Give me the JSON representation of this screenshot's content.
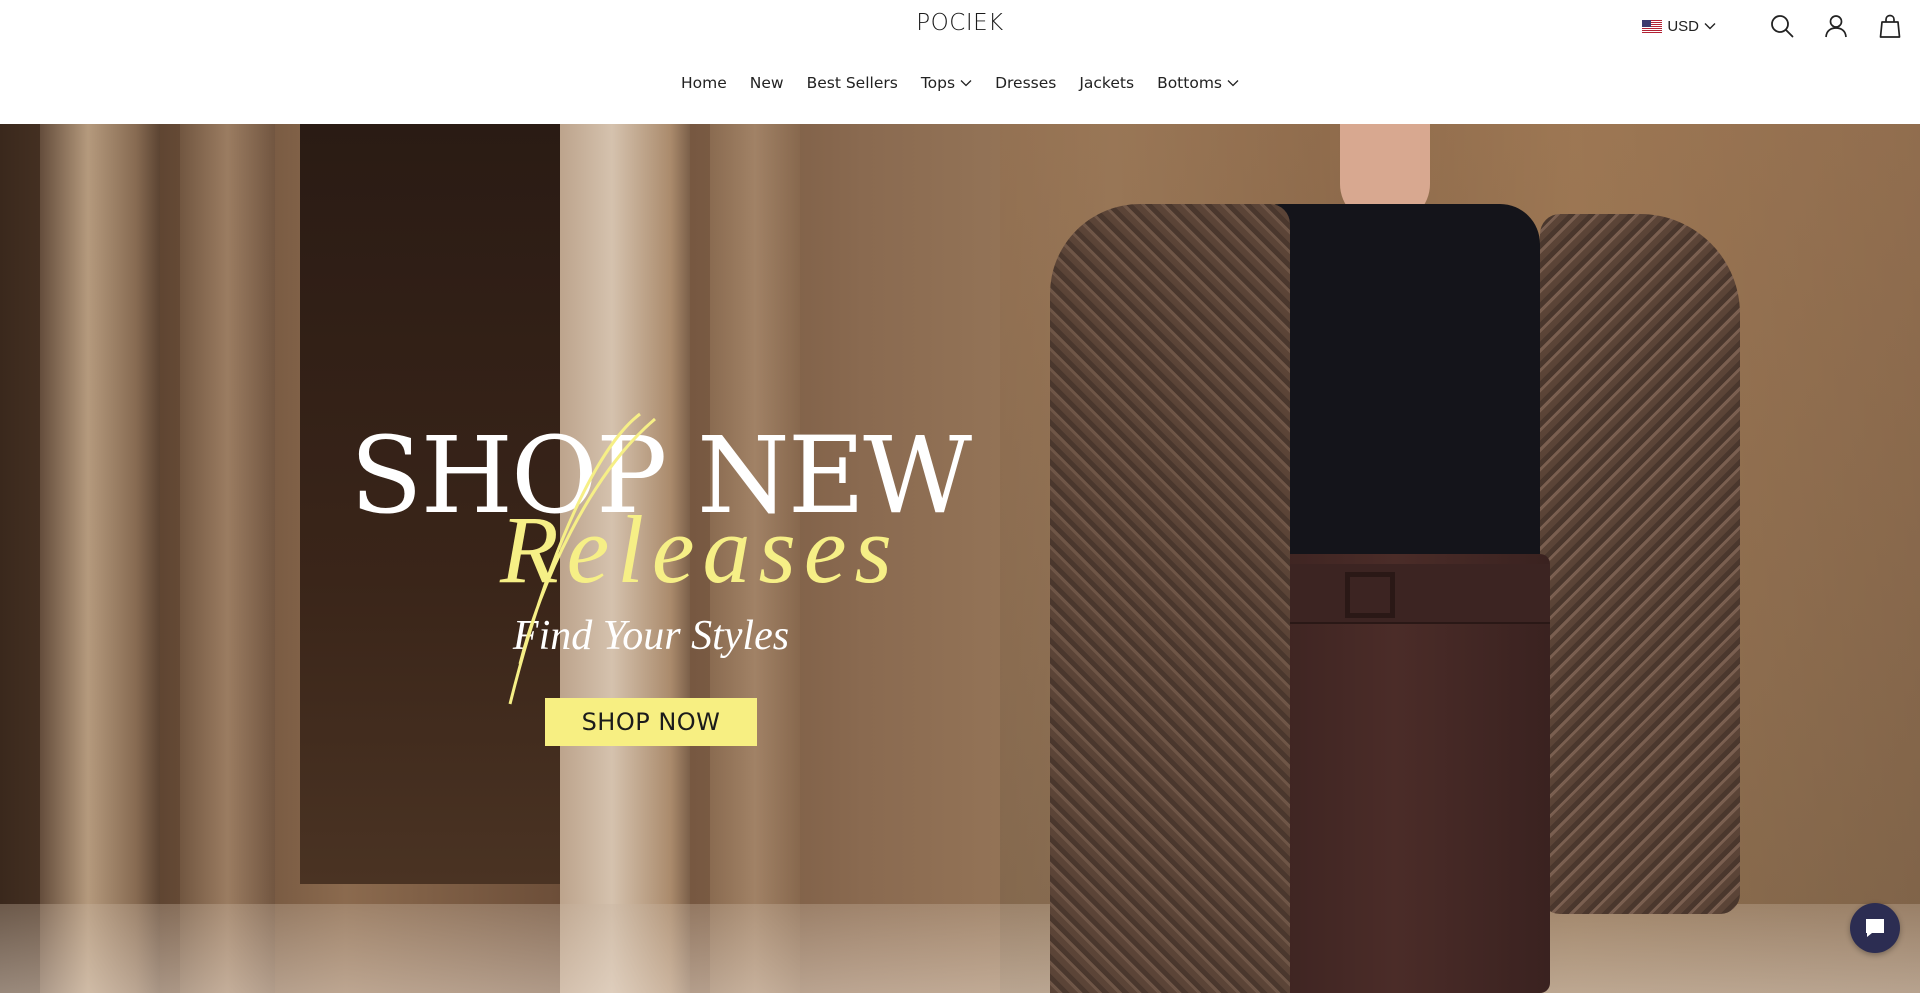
{
  "header": {
    "brand": "POCIEK",
    "currency": "USD"
  },
  "nav": {
    "items": [
      {
        "label": "Home",
        "has_dropdown": false
      },
      {
        "label": "New",
        "has_dropdown": false
      },
      {
        "label": "Best Sellers",
        "has_dropdown": false
      },
      {
        "label": "Tops",
        "has_dropdown": true
      },
      {
        "label": "Dresses",
        "has_dropdown": false
      },
      {
        "label": "Jackets",
        "has_dropdown": false
      },
      {
        "label": "Bottoms",
        "has_dropdown": true
      }
    ]
  },
  "hero": {
    "headline": "SHOP NEW",
    "script": "Releases",
    "subhead": "Find Your Styles",
    "cta": "SHOP NOW"
  },
  "icons": {
    "flag": "us-flag-icon",
    "currency_chevron": "chevron-down-icon",
    "search": "search-icon",
    "account": "user-icon",
    "cart": "shopping-bag-icon",
    "chat": "chat-bubble-icon"
  },
  "colors": {
    "accent_yellow": "#f7ef82",
    "chat_button": "#2c2d52",
    "header_bg": "#ffffff",
    "text": "#1d1d1d"
  }
}
